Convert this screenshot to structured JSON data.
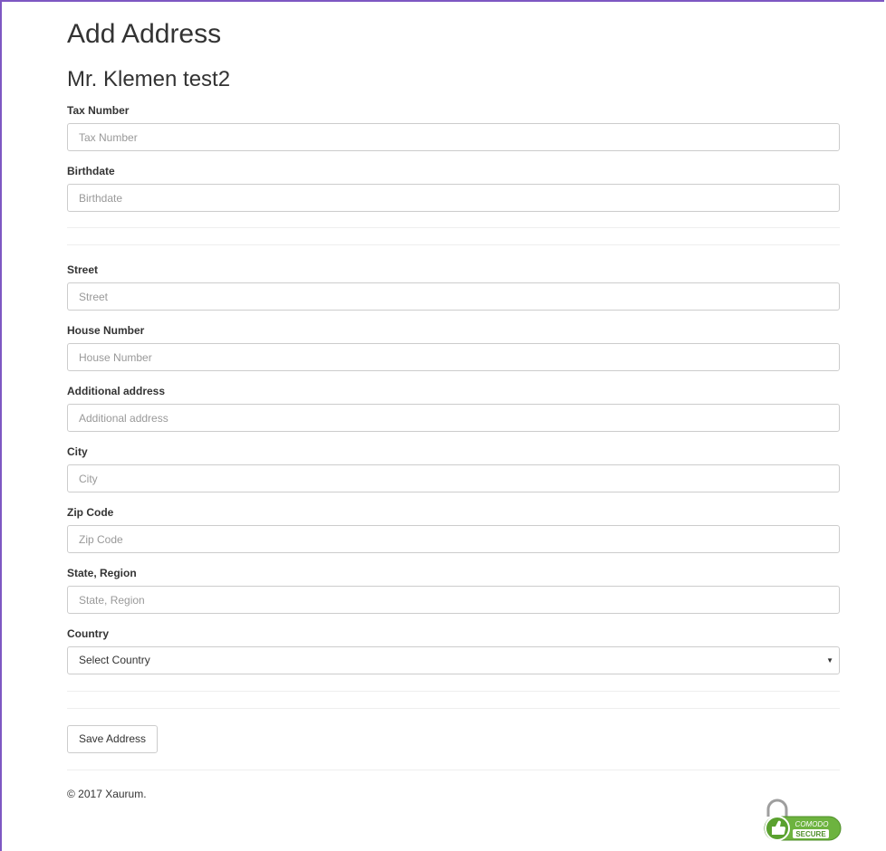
{
  "page": {
    "title": "Add Address",
    "customer_name": "Mr. Klemen test2"
  },
  "personal_fields": [
    {
      "label": "Tax Number",
      "placeholder": "Tax Number"
    },
    {
      "label": "Birthdate",
      "placeholder": "Birthdate"
    }
  ],
  "address_fields": [
    {
      "label": "Street",
      "placeholder": "Street"
    },
    {
      "label": "House Number",
      "placeholder": "House Number"
    },
    {
      "label": "Additional address",
      "placeholder": "Additional address"
    },
    {
      "label": "City",
      "placeholder": "City"
    },
    {
      "label": "Zip Code",
      "placeholder": "Zip Code"
    },
    {
      "label": "State, Region",
      "placeholder": "State, Region"
    }
  ],
  "country": {
    "label": "Country",
    "selected": "Select Country"
  },
  "actions": {
    "save_label": "Save Address"
  },
  "footer": {
    "copyright": "© 2017 Xaurum.",
    "badge": {
      "top_text": "COMODO",
      "bottom_text": "SECURE",
      "icon": "padlock-thumbs-up-icon",
      "color": "#6db33f"
    }
  },
  "colors": {
    "frame_border": "#7e57c2",
    "input_border": "#cccccc",
    "placeholder": "#999999"
  }
}
